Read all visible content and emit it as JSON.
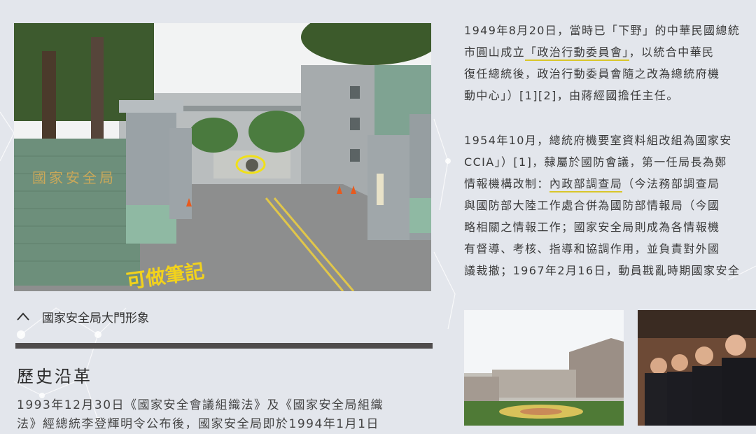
{
  "photo": {
    "sign_text": "國家安全局",
    "annotation": "可做筆記",
    "caption_icon": "chevron-up-icon",
    "caption": "國家安全局大門形象"
  },
  "section": {
    "heading": "歷史沿革",
    "paragraph_lines": [
      "1993年12月30日《國家安全會議組織法》及《國家安全局組織",
      "法》經總統李登輝明令公布後，國家安全局即於1994年1月1日"
    ]
  },
  "article": {
    "p1_lines": [
      {
        "pre": "1949年8月20日，當時已「下野」的中華民國總統",
        "hl": "",
        "post": ""
      },
      {
        "pre": "市圓山成立",
        "hl": "「政治行動委員會」",
        "post": "，以統合中華民"
      },
      {
        "pre": "復任總統後，政治行動委員會隨之改為總統府機",
        "hl": "",
        "post": ""
      },
      {
        "pre": "動中心」）[1][2]，由蔣經國擔任主任。",
        "hl": "",
        "post": ""
      }
    ],
    "p2_lines": [
      {
        "pre": "1954年10月，總統府機要室資料組改組為國家安",
        "hl": "",
        "post": ""
      },
      {
        "pre": "CCIA」）[1]，隸屬於國防會議，第一任局長為鄭",
        "hl": "",
        "post": ""
      },
      {
        "pre": "情報機構改制：",
        "hl": "內政部調查局",
        "post": "（今法務部調查局"
      },
      {
        "pre": "與國防部大陸工作處合併為國防部情報局（今國",
        "hl": "",
        "post": ""
      },
      {
        "pre": "略相關之情報工作；國家安全局則成為各情報機",
        "hl": "",
        "post": ""
      },
      {
        "pre": "有督導、考核、指導和協調作用，並負責對外國",
        "hl": "",
        "post": ""
      },
      {
        "pre": "議裁撤；1967年2月16日，動員戡亂時期國家安全",
        "hl": "",
        "post": ""
      }
    ]
  },
  "colors": {
    "background": "#e3e6ec",
    "highlight": "#d8c62a",
    "divider": "#4f4c4c"
  }
}
